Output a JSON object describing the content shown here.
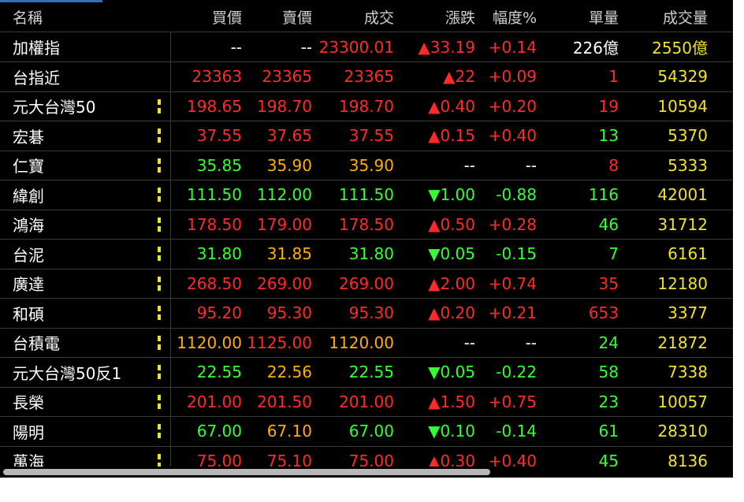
{
  "colors": {
    "red": "#ff2a2a",
    "green": "#33ff33",
    "yellow": "#f2e12a",
    "white": "#ffffff",
    "orange": "#ffae00"
  },
  "header": {
    "name": "名稱",
    "bid": "買價",
    "ask": "賣價",
    "last": "成交",
    "change": "漲跌",
    "pct": "幅度%",
    "vol": "單量",
    "total": "成交量"
  },
  "rows": [
    {
      "name": "加權指",
      "marker": false,
      "bid": "--",
      "ask": "--",
      "last": "23300.01",
      "change": "▲33.19",
      "pct": "+0.14",
      "vol": "226億",
      "total": "2550億",
      "c_bid": "white",
      "c_ask": "white",
      "c_last": "red",
      "c_chg": "red",
      "c_pct": "red",
      "c_vol": "white",
      "c_tot": "yellow"
    },
    {
      "name": "台指近",
      "marker": false,
      "bid": "23363",
      "ask": "23365",
      "last": "23365",
      "change": "▲22",
      "pct": "+0.09",
      "vol": "1",
      "total": "54329",
      "c_bid": "red",
      "c_ask": "red",
      "c_last": "red",
      "c_chg": "red",
      "c_pct": "red",
      "c_vol": "red",
      "c_tot": "yellow"
    },
    {
      "name": "元大台灣50",
      "marker": true,
      "bid": "198.65",
      "ask": "198.70",
      "last": "198.70",
      "change": "▲0.40",
      "pct": "+0.20",
      "vol": "19",
      "total": "10594",
      "c_bid": "red",
      "c_ask": "red",
      "c_last": "red",
      "c_chg": "red",
      "c_pct": "red",
      "c_vol": "red",
      "c_tot": "yellow"
    },
    {
      "name": "宏碁",
      "marker": true,
      "bid": "37.55",
      "ask": "37.65",
      "last": "37.55",
      "change": "▲0.15",
      "pct": "+0.40",
      "vol": "13",
      "total": "5370",
      "c_bid": "red",
      "c_ask": "red",
      "c_last": "red",
      "c_chg": "red",
      "c_pct": "red",
      "c_vol": "green",
      "c_tot": "yellow"
    },
    {
      "name": "仁寶",
      "marker": true,
      "bid": "35.85",
      "ask": "35.90",
      "last": "35.90",
      "change": "--",
      "pct": "--",
      "vol": "8",
      "total": "5333",
      "c_bid": "green",
      "c_ask": "orange",
      "c_last": "orange",
      "c_chg": "white",
      "c_pct": "white",
      "c_vol": "red",
      "c_tot": "yellow"
    },
    {
      "name": "緯創",
      "marker": true,
      "bid": "111.50",
      "ask": "112.00",
      "last": "111.50",
      "change": "▼1.00",
      "pct": "-0.88",
      "vol": "116",
      "total": "42001",
      "c_bid": "green",
      "c_ask": "green",
      "c_last": "green",
      "c_chg": "green",
      "c_pct": "green",
      "c_vol": "green",
      "c_tot": "yellow"
    },
    {
      "name": "鴻海",
      "marker": true,
      "bid": "178.50",
      "ask": "179.00",
      "last": "178.50",
      "change": "▲0.50",
      "pct": "+0.28",
      "vol": "46",
      "total": "31712",
      "c_bid": "red",
      "c_ask": "red",
      "c_last": "red",
      "c_chg": "red",
      "c_pct": "red",
      "c_vol": "green",
      "c_tot": "yellow"
    },
    {
      "name": "台泥",
      "marker": true,
      "bid": "31.80",
      "ask": "31.85",
      "last": "31.80",
      "change": "▼0.05",
      "pct": "-0.15",
      "vol": "7",
      "total": "6161",
      "c_bid": "green",
      "c_ask": "orange",
      "c_last": "green",
      "c_chg": "green",
      "c_pct": "green",
      "c_vol": "green",
      "c_tot": "yellow"
    },
    {
      "name": "廣達",
      "marker": true,
      "bid": "268.50",
      "ask": "269.00",
      "last": "269.00",
      "change": "▲2.00",
      "pct": "+0.74",
      "vol": "35",
      "total": "12180",
      "c_bid": "red",
      "c_ask": "red",
      "c_last": "red",
      "c_chg": "red",
      "c_pct": "red",
      "c_vol": "red",
      "c_tot": "yellow"
    },
    {
      "name": "和碩",
      "marker": true,
      "bid": "95.20",
      "ask": "95.30",
      "last": "95.30",
      "change": "▲0.20",
      "pct": "+0.21",
      "vol": "653",
      "total": "3377",
      "c_bid": "red",
      "c_ask": "red",
      "c_last": "red",
      "c_chg": "red",
      "c_pct": "red",
      "c_vol": "red",
      "c_tot": "yellow"
    },
    {
      "name": "台積電",
      "marker": true,
      "bid": "1120.00",
      "ask": "1125.00",
      "last": "1120.00",
      "change": "--",
      "pct": "--",
      "vol": "24",
      "total": "21872",
      "c_bid": "orange",
      "c_ask": "red",
      "c_last": "orange",
      "c_chg": "white",
      "c_pct": "white",
      "c_vol": "green",
      "c_tot": "yellow"
    },
    {
      "name": "元大台灣50反1",
      "marker": true,
      "bid": "22.55",
      "ask": "22.56",
      "last": "22.55",
      "change": "▼0.05",
      "pct": "-0.22",
      "vol": "58",
      "total": "7338",
      "c_bid": "green",
      "c_ask": "orange",
      "c_last": "green",
      "c_chg": "green",
      "c_pct": "green",
      "c_vol": "green",
      "c_tot": "yellow"
    },
    {
      "name": "長榮",
      "marker": true,
      "bid": "201.00",
      "ask": "201.50",
      "last": "201.00",
      "change": "▲1.50",
      "pct": "+0.75",
      "vol": "23",
      "total": "10057",
      "c_bid": "red",
      "c_ask": "red",
      "c_last": "red",
      "c_chg": "red",
      "c_pct": "red",
      "c_vol": "green",
      "c_tot": "yellow"
    },
    {
      "name": "陽明",
      "marker": true,
      "bid": "67.00",
      "ask": "67.10",
      "last": "67.00",
      "change": "▼0.10",
      "pct": "-0.14",
      "vol": "61",
      "total": "28310",
      "c_bid": "green",
      "c_ask": "orange",
      "c_last": "green",
      "c_chg": "green",
      "c_pct": "green",
      "c_vol": "green",
      "c_tot": "yellow"
    },
    {
      "name": "萬海",
      "marker": true,
      "bid": "75.00",
      "ask": "75.10",
      "last": "75.00",
      "change": "▲0.30",
      "pct": "+0.40",
      "vol": "45",
      "total": "8136",
      "c_bid": "red",
      "c_ask": "red",
      "c_last": "red",
      "c_chg": "red",
      "c_pct": "red",
      "c_vol": "green",
      "c_tot": "yellow"
    }
  ]
}
